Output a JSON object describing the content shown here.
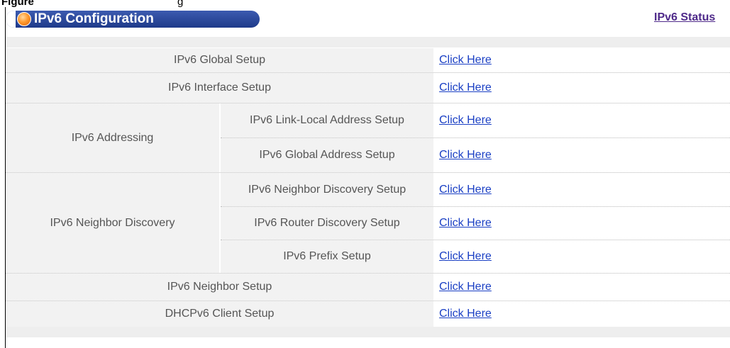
{
  "caption": {
    "part1": "Figure",
    "part2": "g"
  },
  "header": {
    "title": "IPv6 Configuration",
    "status_link": "IPv6 Status"
  },
  "rows": {
    "global": {
      "label": "IPv6 Global Setup",
      "link": "Click Here"
    },
    "interface": {
      "label": "IPv6 Interface Setup",
      "link": "Click Here"
    },
    "addressing": {
      "label": "IPv6 Addressing",
      "sub": [
        {
          "label": "IPv6 Link-Local Address Setup",
          "link": "Click Here"
        },
        {
          "label": "IPv6 Global Address Setup",
          "link": "Click Here"
        }
      ]
    },
    "neighbor_discovery": {
      "label": "IPv6 Neighbor Discovery",
      "sub": [
        {
          "label": "IPv6 Neighbor Discovery Setup",
          "link": "Click Here"
        },
        {
          "label": "IPv6 Router Discovery Setup",
          "link": "Click Here"
        },
        {
          "label": "IPv6 Prefix Setup",
          "link": "Click Here"
        }
      ]
    },
    "neighbor": {
      "label": "IPv6 Neighbor Setup",
      "link": "Click Here"
    },
    "dhcpv6": {
      "label": "DHCPv6 Client Setup",
      "link": "Click Here"
    }
  }
}
